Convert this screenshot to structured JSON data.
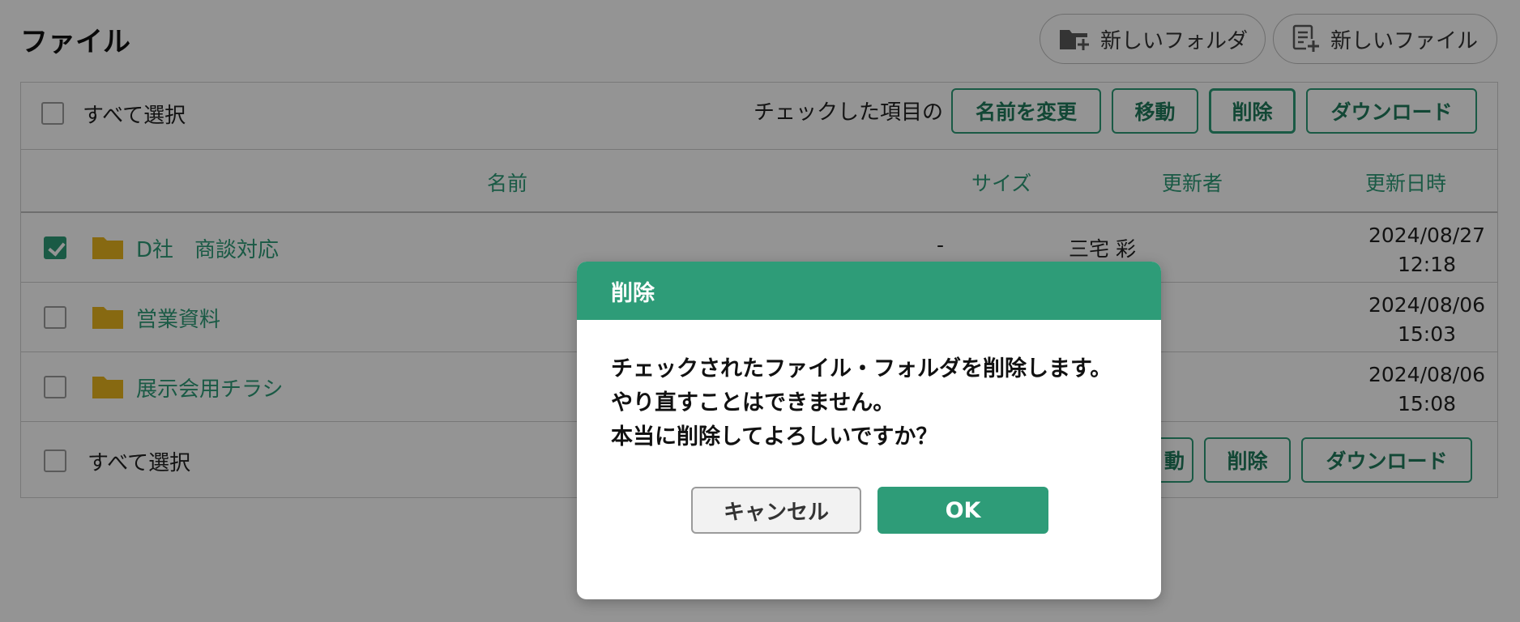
{
  "page": {
    "title": "ファイル"
  },
  "header_actions": {
    "new_folder": "新しいフォルダ",
    "new_file": "新しいファイル"
  },
  "toolbar": {
    "select_all": "すべて選択",
    "checked_items_label": "チェックした項目の",
    "rename": "名前を変更",
    "move": "移動",
    "delete": "削除",
    "download": "ダウンロード"
  },
  "table": {
    "columns": {
      "name": "名前",
      "size": "サイズ",
      "updated_by": "更新者",
      "updated_at": "更新日時"
    },
    "rows": [
      {
        "name": "D社　商談対応",
        "size": "-",
        "updated_by": "三宅 彩",
        "date": "2024/08/27",
        "time": "12:18",
        "checked": true
      },
      {
        "name": "営業資料",
        "size": "",
        "updated_by": "",
        "date": "2024/08/06",
        "time": "15:03",
        "checked": false
      },
      {
        "name": "展示会用チラシ",
        "size": "",
        "updated_by": "",
        "date": "2024/08/06",
        "time": "15:08",
        "checked": false
      }
    ]
  },
  "bottom_toolbar": {
    "select_all": "すべて選択",
    "move_partial": "動",
    "delete": "削除",
    "download": "ダウンロード"
  },
  "dialog": {
    "title": "削除",
    "message": [
      "チェックされたファイル・フォルダを削除します。",
      "やり直すことはできません。",
      "本当に削除してよろしいですか？"
    ],
    "cancel": "キャンセル",
    "ok": "OK"
  },
  "colors": {
    "accent": "#2e9c78",
    "folder": "#e8b51e",
    "overlay": "rgba(0,0,0,0.42)"
  },
  "icons": {
    "new_folder": "folder-plus-icon",
    "new_file": "file-plus-icon",
    "folder": "folder-icon",
    "checkbox": "checkbox-icon"
  }
}
